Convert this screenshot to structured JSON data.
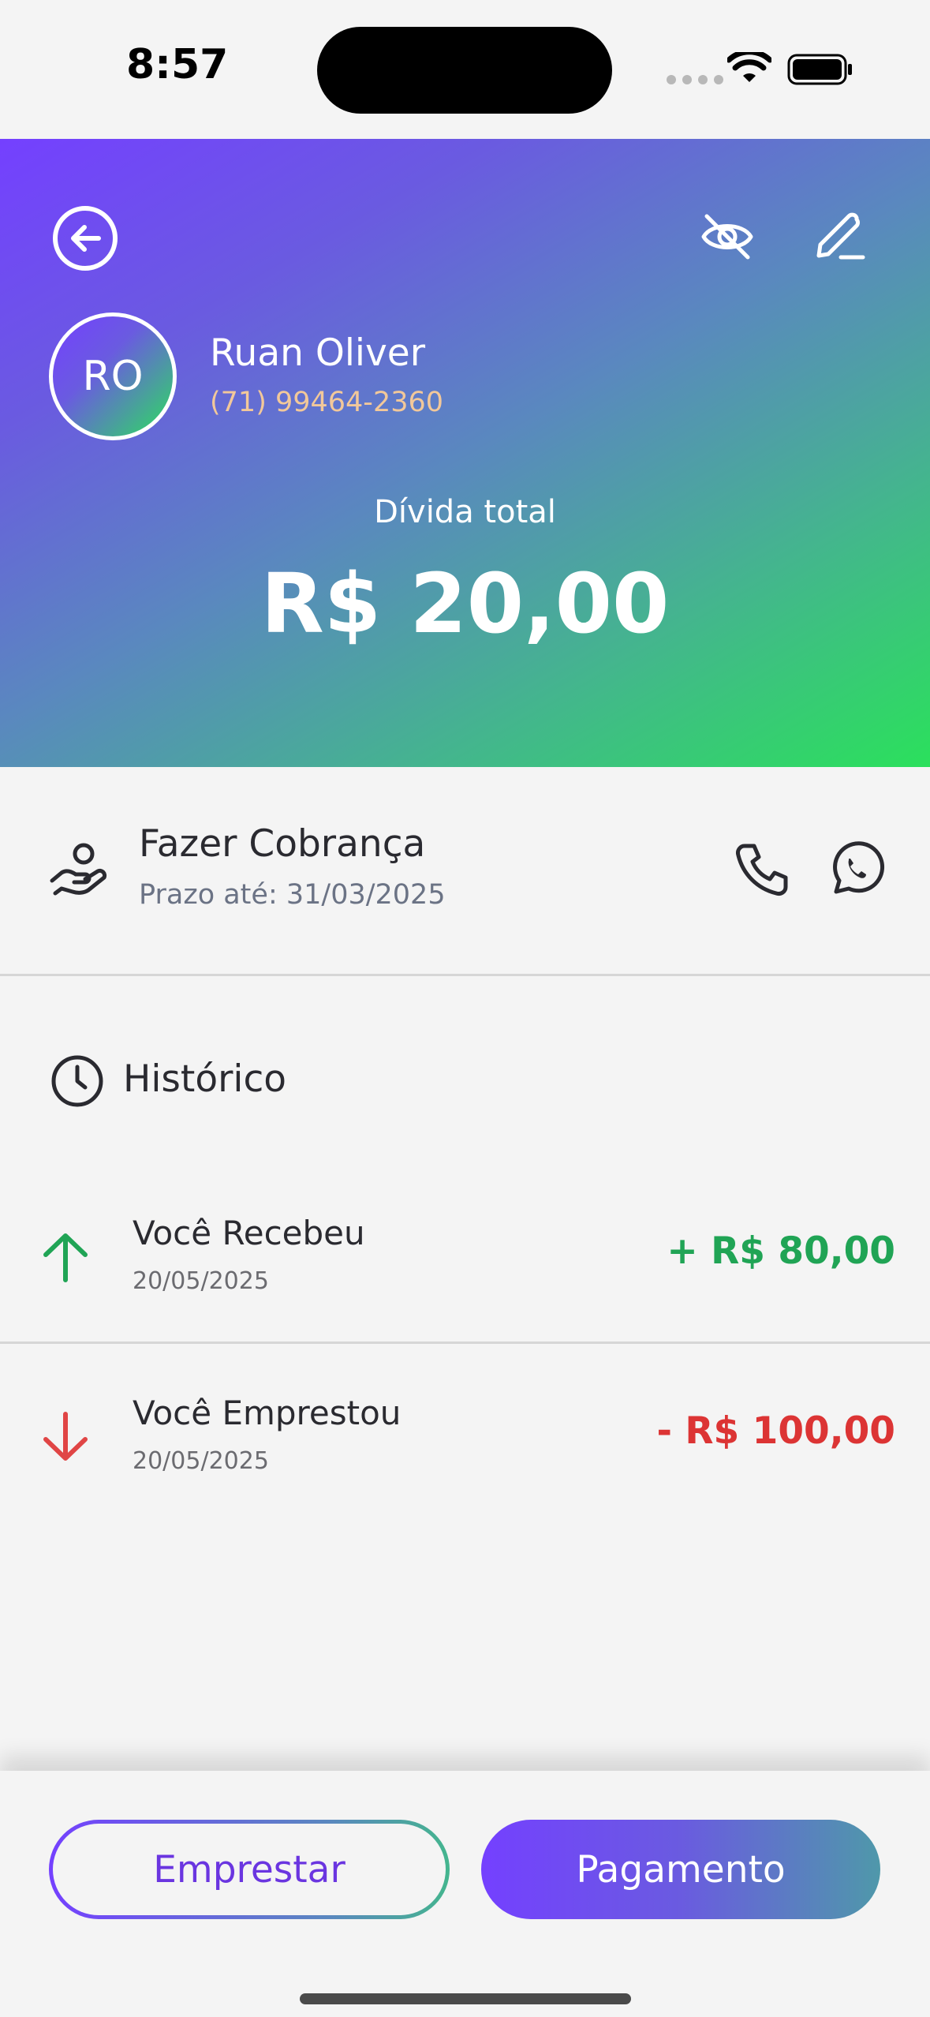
{
  "status_bar": {
    "time": "8:57"
  },
  "contact": {
    "initials": "RO",
    "name": "Ruan Oliver",
    "phone": "(71) 99464-2360"
  },
  "debt": {
    "label": "Dívida total",
    "value": "R$ 20,00"
  },
  "cobranca": {
    "title": "Fazer Cobrança",
    "deadline": "Prazo até: 31/03/2025"
  },
  "history": {
    "title": "Histórico",
    "items": [
      {
        "title": "Você Recebeu",
        "date": "20/05/2025",
        "amount": "+ R$ 80,00",
        "direction": "in",
        "color": "#20a455"
      },
      {
        "title": "Você Emprestou",
        "date": "20/05/2025",
        "amount": "- R$ 100,00",
        "direction": "out",
        "color": "#dc3434"
      }
    ]
  },
  "actions": {
    "lend_label": "Emprestar",
    "payment_label": "Pagamento"
  },
  "colors": {
    "accent_purple": "#7440ff",
    "accent_green": "#2be05c",
    "positive": "#20a455",
    "negative": "#dc3434"
  }
}
